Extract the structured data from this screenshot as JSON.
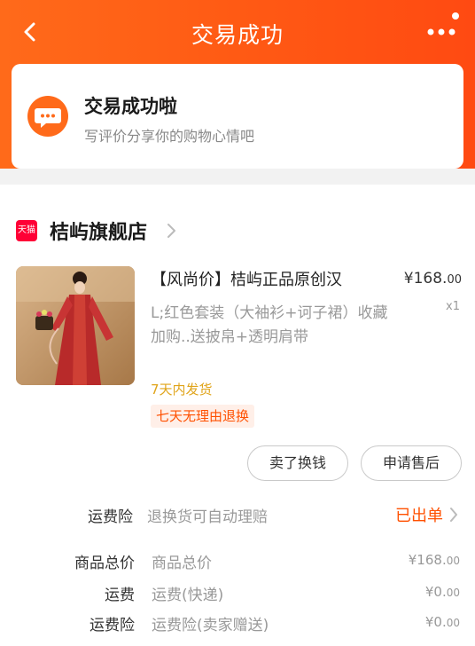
{
  "nav": {
    "title": "交易成功"
  },
  "status": {
    "title": "交易成功啦",
    "subtitle": "写评价分享你的购物心情吧"
  },
  "store": {
    "badge": "天猫",
    "name": "桔屿旗舰店"
  },
  "product": {
    "title": "【风尚价】桔屿正品原创汉",
    "spec": "L;红色套装（大袖衫+诃子裙）收藏加购..送披帛+透明肩带",
    "price_main": "¥168.",
    "price_cents": "00",
    "quantity": "x1",
    "ship_time": "7天内发货",
    "return_policy": "七天无理由退换"
  },
  "actions": {
    "sell_label": "卖了换钱",
    "after_sale_label": "申请售后"
  },
  "freight_insurance": {
    "label": "运费险",
    "desc": "退换货可自动理赔",
    "status": "已出单"
  },
  "summary": [
    {
      "label": "商品总价",
      "desc": "商品总价",
      "value_main": "¥168.",
      "value_cents": "00"
    },
    {
      "label": "运费",
      "desc": "运费(快递)",
      "value_main": "¥0.",
      "value_cents": "00"
    },
    {
      "label": "运费险",
      "desc": "运费险(卖家赠送)",
      "value_main": "¥0.",
      "value_cents": "00"
    }
  ],
  "colors": {
    "brand_orange": "#ff5a14",
    "accent_red": "#ff5000",
    "tmall_red": "#ff0036",
    "ship_yellow": "#e0a41a"
  }
}
